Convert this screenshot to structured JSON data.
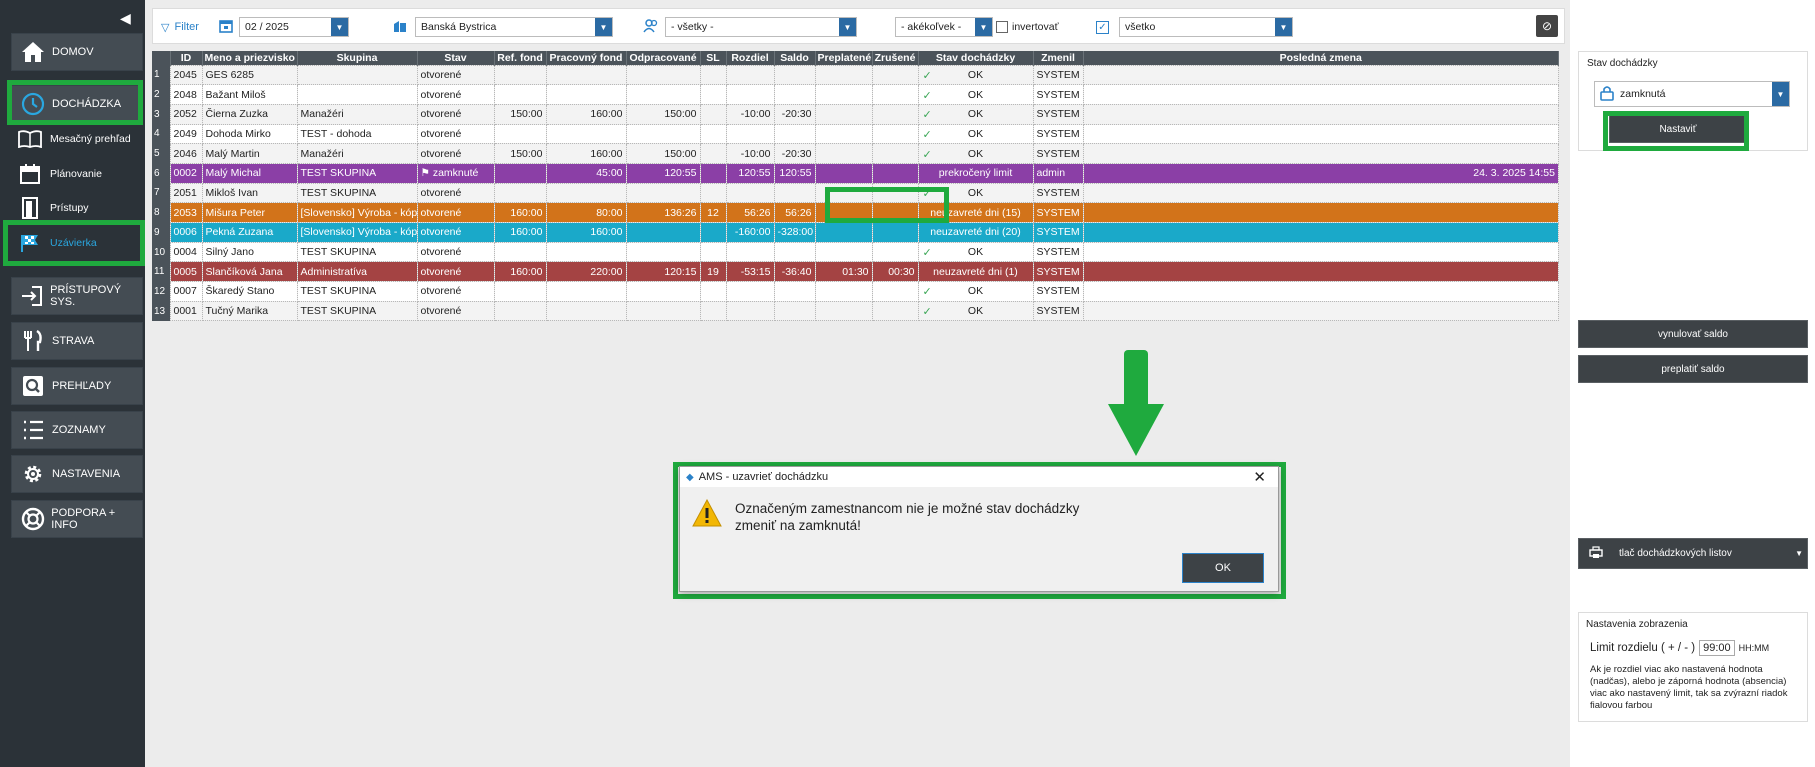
{
  "sidebar": {
    "collapse": "◀",
    "items": [
      {
        "label": "DOMOV",
        "icon": "home-icon"
      },
      {
        "label": "DOCHÁDZKA",
        "icon": "clock-icon"
      },
      {
        "label": "Mesačný prehľad",
        "icon": "book-icon"
      },
      {
        "label": "Plánovanie",
        "icon": "calendar-icon"
      },
      {
        "label": "Prístupy",
        "icon": "door-icon"
      },
      {
        "label": "Uzávierka",
        "icon": "flag-icon"
      },
      {
        "label": "PRÍSTUPOVÝ SYS.",
        "icon": "enter-icon"
      },
      {
        "label": "STRAVA",
        "icon": "cutlery-icon"
      },
      {
        "label": "PREHĽADY",
        "icon": "magnifier-icon"
      },
      {
        "label": "ZOZNAMY",
        "icon": "list-icon"
      },
      {
        "label": "NASTAVENIA",
        "icon": "gear-icon"
      },
      {
        "label": "PODPORA + INFO",
        "icon": "lifebuoy-icon"
      }
    ]
  },
  "toolbar": {
    "filter_label": "Filter",
    "period": "02 / 2025",
    "location": "Banská Bystrica",
    "group": "- všetky -",
    "state": "- akékoľvek -",
    "invert_label": "invertovať",
    "all_label": "všetko",
    "cancel_icon": "⊘"
  },
  "table": {
    "columns": [
      "ID",
      "Meno a priezvisko",
      "Skupina",
      "Stav",
      "Ref. fond",
      "Pracovný fond",
      "Odpracované",
      "SL",
      "Rozdiel",
      "Saldo",
      "Preplatené",
      "Zrušené",
      "Stav dochádzky",
      "Zmenil",
      "Posledná zmena"
    ],
    "rows": [
      {
        "n": "1",
        "id": "2045",
        "name": " GES 6285",
        "group": "",
        "state": "otvorené",
        "ref": "",
        "fund": "",
        "worked": "",
        "sl": "",
        "diff": "",
        "saldo": "",
        "paid": "",
        "cancel": "",
        "att": "OK",
        "chk": true,
        "by": "SYSTEM",
        "last": ""
      },
      {
        "n": "2",
        "id": "2048",
        "name": "Bažant Miloš",
        "group": "",
        "state": "otvorené",
        "ref": "",
        "fund": "",
        "worked": "",
        "sl": "",
        "diff": "",
        "saldo": "",
        "paid": "",
        "cancel": "",
        "att": "OK",
        "chk": true,
        "by": "SYSTEM",
        "last": ""
      },
      {
        "n": "3",
        "id": "2052",
        "name": "Čierna Zuzka",
        "group": "Manažéri",
        "state": "otvorené",
        "ref": "150:00",
        "fund": "160:00",
        "worked": "150:00",
        "sl": "",
        "diff": "-10:00",
        "saldo": "-20:30",
        "paid": "",
        "cancel": "",
        "att": "OK",
        "chk": true,
        "by": "SYSTEM",
        "last": ""
      },
      {
        "n": "4",
        "id": "2049",
        "name": "Dohoda Mirko",
        "group": "TEST - dohoda",
        "state": "otvorené",
        "ref": "",
        "fund": "",
        "worked": "",
        "sl": "",
        "diff": "",
        "saldo": "",
        "paid": "",
        "cancel": "",
        "att": "OK",
        "chk": true,
        "by": "SYSTEM",
        "last": ""
      },
      {
        "n": "5",
        "id": "2046",
        "name": "Malý Martin",
        "group": "Manažéri",
        "state": "otvorené",
        "ref": "150:00",
        "fund": "160:00",
        "worked": "150:00",
        "sl": "",
        "diff": "-10:00",
        "saldo": "-20:30",
        "paid": "",
        "cancel": "",
        "att": "OK",
        "chk": true,
        "by": "SYSTEM",
        "last": ""
      },
      {
        "n": "6",
        "id": "0002",
        "name": "Malý Michal",
        "group": "TEST SKUPINA",
        "state": "zamknuté",
        "ref": "",
        "fund": "45:00",
        "worked": "120:55",
        "sl": "",
        "diff": "120:55",
        "saldo": "120:55",
        "paid": "",
        "cancel": "",
        "att": "prekročený limit",
        "chk": false,
        "by": "admin",
        "last": "24. 3. 2025 14:55"
      },
      {
        "n": "7",
        "id": "2051",
        "name": "Mikloš Ivan",
        "group": "TEST SKUPINA",
        "state": "otvorené",
        "ref": "",
        "fund": "",
        "worked": "",
        "sl": "",
        "diff": "",
        "saldo": "",
        "paid": "",
        "cancel": "",
        "att": "OK",
        "chk": true,
        "by": "SYSTEM",
        "last": ""
      },
      {
        "n": "8",
        "id": "2053",
        "name": "Mišura Peter",
        "group": "[Slovensko] Výroba - kópia",
        "state": "otvorené",
        "ref": "160:00",
        "fund": "80:00",
        "worked": "136:26",
        "sl": "12",
        "diff": "56:26",
        "saldo": "56:26",
        "paid": "",
        "cancel": "",
        "att": "neuzavreté dni (15)",
        "chk": false,
        "by": "SYSTEM",
        "last": ""
      },
      {
        "n": "9",
        "id": "0006",
        "name": "Pekná Zuzana",
        "group": "[Slovensko] Výroba - kópia",
        "state": "otvorené",
        "ref": "160:00",
        "fund": "160:00",
        "worked": "",
        "sl": "",
        "diff": "-160:00",
        "saldo": "-328:00",
        "paid": "",
        "cancel": "",
        "att": "neuzavreté dni (20)",
        "chk": false,
        "by": "SYSTEM",
        "last": ""
      },
      {
        "n": "10",
        "id": "0004",
        "name": "Silný Jano",
        "group": "TEST SKUPINA",
        "state": "otvorené",
        "ref": "",
        "fund": "",
        "worked": "",
        "sl": "",
        "diff": "",
        "saldo": "",
        "paid": "",
        "cancel": "",
        "att": "OK",
        "chk": true,
        "by": "SYSTEM",
        "last": ""
      },
      {
        "n": "11",
        "id": "0005",
        "name": "Slančíková Jana",
        "group": "Administratíva",
        "state": "otvorené",
        "ref": "160:00",
        "fund": "220:00",
        "worked": "120:15",
        "sl": "19",
        "diff": "-53:15",
        "saldo": "-36:40",
        "paid": "01:30",
        "cancel": "00:30",
        "att": "neuzavreté dni (1)",
        "chk": false,
        "by": "SYSTEM",
        "last": ""
      },
      {
        "n": "12",
        "id": "0007",
        "name": "Škaredý Stano",
        "group": "TEST SKUPINA",
        "state": "otvorené",
        "ref": "",
        "fund": "",
        "worked": "",
        "sl": "",
        "diff": "",
        "saldo": "",
        "paid": "",
        "cancel": "",
        "att": "OK",
        "chk": true,
        "by": "SYSTEM",
        "last": ""
      },
      {
        "n": "13",
        "id": "0001",
        "name": "Tučný Marika",
        "group": "TEST SKUPINA",
        "state": "otvorené",
        "ref": "",
        "fund": "",
        "worked": "",
        "sl": "",
        "diff": "",
        "saldo": "",
        "paid": "",
        "cancel": "",
        "att": "OK",
        "chk": true,
        "by": "SYSTEM",
        "last": ""
      }
    ]
  },
  "dialog": {
    "title": "AMS - uzavrieť dochádzku",
    "message": "Označeným zamestnancom nie je možné stav dochádzky zmeniť na zamknutá!",
    "ok": "OK"
  },
  "right_panel": {
    "status_title": "Stav dochádzky",
    "status_value": "zamknutá",
    "set_button": "Nastaviť",
    "reset_saldo": "vynulovať saldo",
    "pay_saldo": "preplatiť saldo",
    "print_button": "tlač dochádzkových listov",
    "display_title": "Nastavenia zobrazenia",
    "limit_label": "Limit rozdielu ( + / - )",
    "limit_value": "99:00",
    "limit_unit": "HH:MM",
    "limit_help": "Ak je rozdiel viac ako nastavená hodnota (nadčas), alebo je záporná hodnota (absencia) viac ako nastavený limit, tak sa zvýrazní riadok fialovou farbou"
  }
}
